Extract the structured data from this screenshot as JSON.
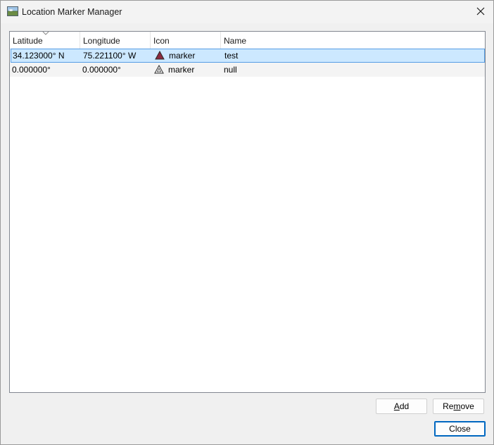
{
  "window": {
    "title": "Location Marker Manager",
    "app_icon": "landscape-icon",
    "close_icon": "close-icon"
  },
  "table": {
    "columns": [
      "Latitude",
      "Longitude",
      "Icon",
      "Name"
    ],
    "sort_column": "Latitude",
    "rows": [
      {
        "latitude": "34.123000° N",
        "longitude": "75.221100° W",
        "icon": "marker",
        "icon_color": "#8b2a3f",
        "name": "test",
        "selected": true
      },
      {
        "latitude": "0.000000°",
        "longitude": "0.000000°",
        "icon": "marker",
        "icon_color": "#ffffff",
        "name": "null",
        "selected": false
      }
    ]
  },
  "buttons": {
    "add_mnemonic": "A",
    "add_rest": "dd",
    "remove_prefix": "Re",
    "remove_mnemonic": "m",
    "remove_rest": "ove",
    "close": "Close"
  },
  "colors": {
    "selection_bg": "#cce8ff",
    "selection_border": "#569de5",
    "default_button_border": "#0067c0"
  }
}
